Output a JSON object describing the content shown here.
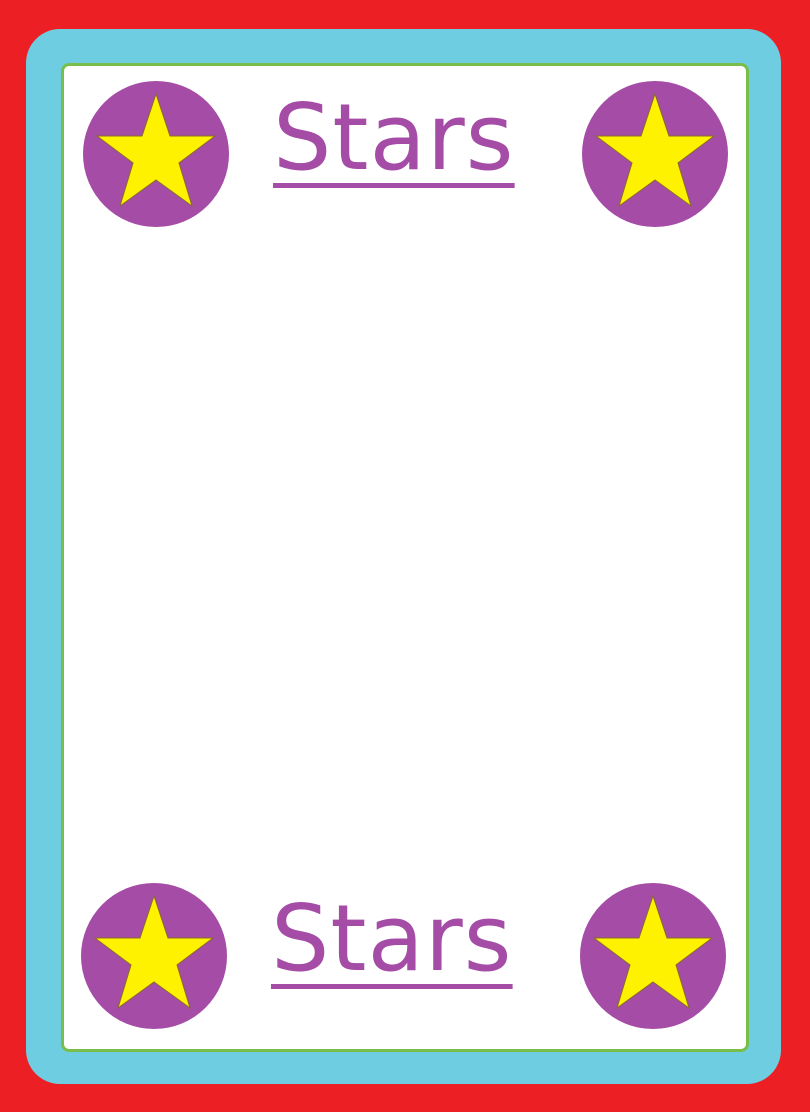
{
  "card": {
    "title_top": "Stars",
    "title_bottom": "Stars"
  },
  "colors": {
    "background": "#ec2024",
    "frame": "#6ecde0",
    "panel": "#ffffff",
    "panel_border": "#79be4b",
    "badge_circle": "#a44ca6",
    "star": "#fff200",
    "title_text": "#a44ca6"
  },
  "icons": {
    "corner_badge": "star-icon"
  }
}
